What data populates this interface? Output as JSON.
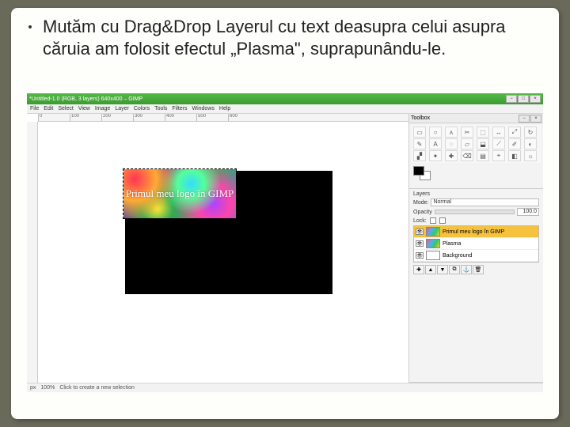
{
  "slide": {
    "bullet_text": "Mutăm cu Drag&Drop Layerul cu text deasupra celui asupra căruia am folosit efectul „Plasma\", suprapunându-le."
  },
  "gimp": {
    "title": "*Untitled-1.0 (RGB, 3 layers) 640x400 – GIMP",
    "menu": [
      "File",
      "Edit",
      "Select",
      "View",
      "Image",
      "Layer",
      "Colors",
      "Tools",
      "Filters",
      "Windows",
      "Help"
    ],
    "ruler_ticks": [
      "0",
      "100",
      "200",
      "300",
      "400",
      "500",
      "600"
    ],
    "canvas_text": "Primul meu logo în GIMP",
    "status_left": "px",
    "status_zoom": "100%",
    "status_hint": "Click to create a new selection"
  },
  "toolbox": {
    "title": "Toolbox",
    "tools": [
      "▭",
      "○",
      "ᴧ",
      "✂",
      "⬚",
      "↔",
      "⤢",
      "↻",
      "✎",
      "A",
      "◌",
      "▱",
      "⬓",
      "⟋",
      "✐",
      "◐",
      "▞",
      "✦",
      "✚",
      "⌫",
      "▤",
      "⌖",
      "◧",
      "☼"
    ]
  },
  "layers": {
    "title": "Layers",
    "mode_label": "Mode:",
    "mode_value": "Normal",
    "opacity_label": "Opacity",
    "opacity_value": "100.0",
    "lock_label": "Lock:",
    "items": [
      {
        "name": "Primul meu logo în GIMP"
      },
      {
        "name": "Plasma"
      },
      {
        "name": "Background"
      }
    ]
  }
}
